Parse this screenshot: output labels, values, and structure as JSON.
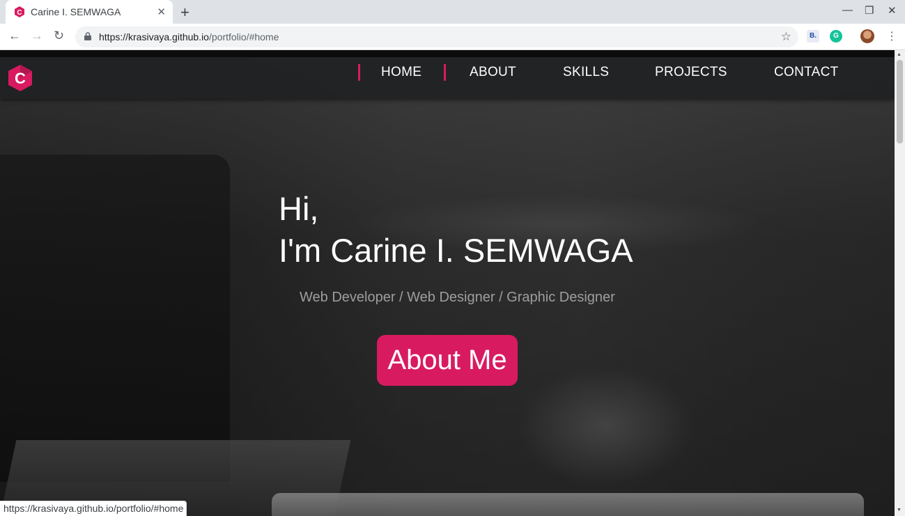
{
  "browser": {
    "tab": {
      "title": "Carine I. SEMWAGA",
      "close": "✕"
    },
    "new_tab": "+",
    "window_controls": {
      "minimize": "—",
      "restore": "❐",
      "close": "✕"
    },
    "nav": {
      "back": "←",
      "forward": "→",
      "reload": "↻"
    },
    "url_host": "https://krasivaya.github.io",
    "url_path": "/portfolio/#home",
    "bookmark_star": "☆",
    "extensions": [
      {
        "name": "B.",
        "color": "#1a4fa0"
      },
      {
        "name": "G",
        "color": "#15c39a"
      }
    ],
    "menu": "⋮",
    "status_url": "https://krasivaya.github.io/portfolio/#home"
  },
  "site": {
    "brand_color": "#d81b60",
    "logo_letter": "C",
    "nav_items": [
      "HOME",
      "ABOUT",
      "SKILLS",
      "PROJECTS",
      "CONTACT"
    ],
    "active_nav": "HOME",
    "hero": {
      "greeting": "Hi,",
      "headline": "I'm Carine I. SEMWAGA",
      "roles": "Web Developer / Web Designer / Graphic Designer",
      "cta": "About Me"
    }
  }
}
